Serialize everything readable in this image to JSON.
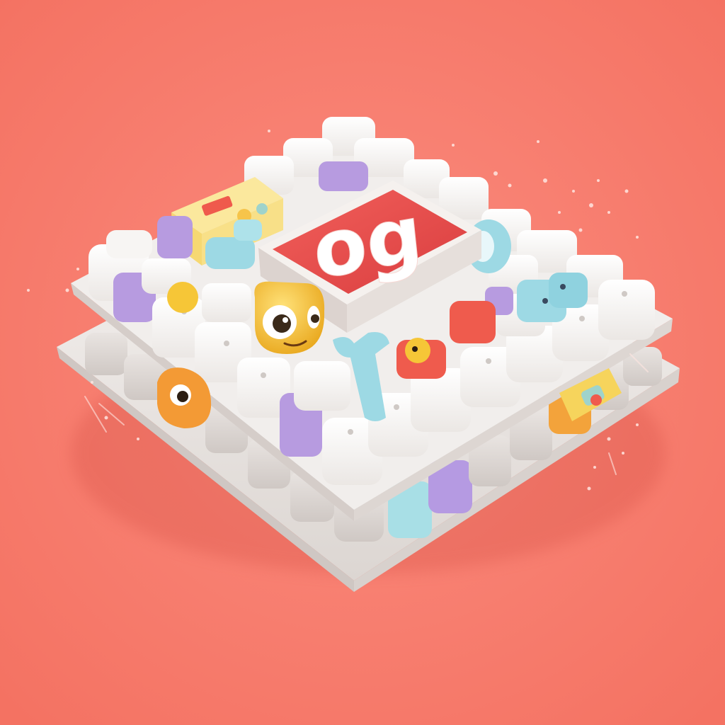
{
  "image": {
    "description_kind": "3D render",
    "background_color": "#f87d6f",
    "palette": {
      "tray": "#ececec",
      "cube": "#f2f0ee",
      "cube_shade": "#d9d4d1",
      "purple": "#b79be0",
      "blue": "#9dd9e4",
      "sign_red": "#ec4b4b",
      "sign_frame": "#f5f1ee",
      "yellow": "#f6c637",
      "orange": "#f39a35"
    },
    "logo": {
      "text": "og",
      "color": "#ffffff"
    }
  }
}
